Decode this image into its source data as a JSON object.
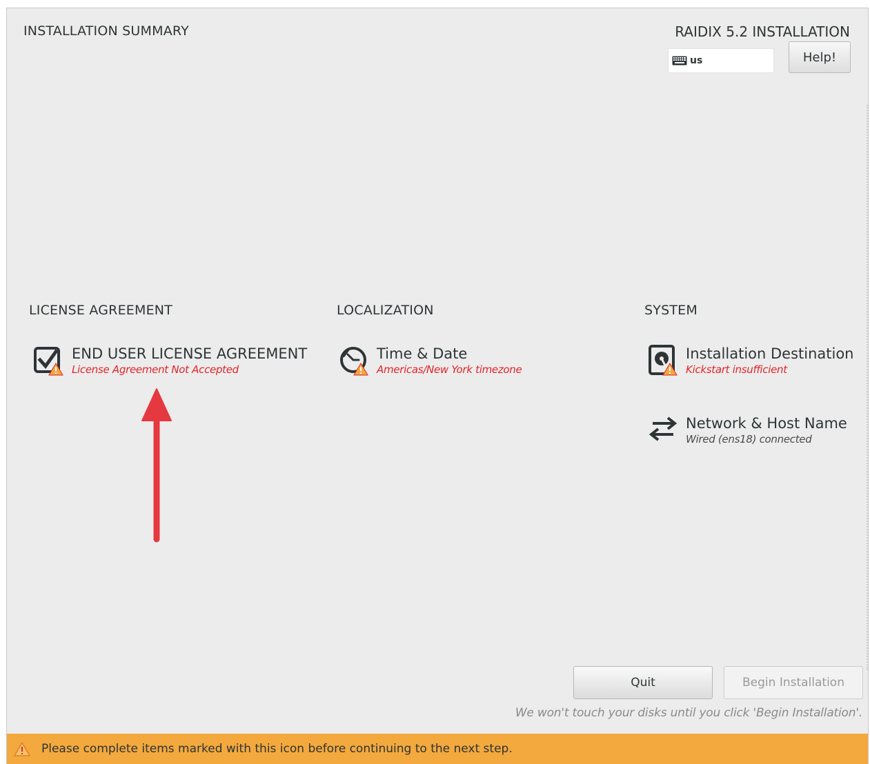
{
  "header": {
    "summary_title": "INSTALLATION SUMMARY",
    "product_title": "RAIDIX 5.2 INSTALLATION",
    "keyboard_layout": "us",
    "help_label": "Help!"
  },
  "sections": {
    "license": {
      "heading": "LICENSE AGREEMENT",
      "eula_title": "END USER LICENSE AGREEMENT",
      "eula_status": "License Agreement Not Accepted"
    },
    "localization": {
      "heading": "LOCALIZATION",
      "time_title": "Time & Date",
      "time_status": "Americas/New York timezone"
    },
    "system": {
      "heading": "SYSTEM",
      "dest_title": "Installation Destination",
      "dest_status": "Kickstart insufficient",
      "network_title": "Network & Host Name",
      "network_status": "Wired (ens18) connected"
    }
  },
  "footer": {
    "quit_label": "Quit",
    "begin_label": "Begin Installation",
    "note": "We won't touch your disks until you click 'Begin Installation'.",
    "warning": "Please complete items marked with this icon before continuing to the next step."
  },
  "colors": {
    "warning_bar": "#f3a93d",
    "warning_text": "#e0242a",
    "arrow": "#e5393f"
  },
  "icons": [
    "keyboard-icon",
    "eula-checkbox-icon",
    "clock-icon",
    "disk-icon",
    "network-arrows-icon",
    "warning-icon"
  ]
}
